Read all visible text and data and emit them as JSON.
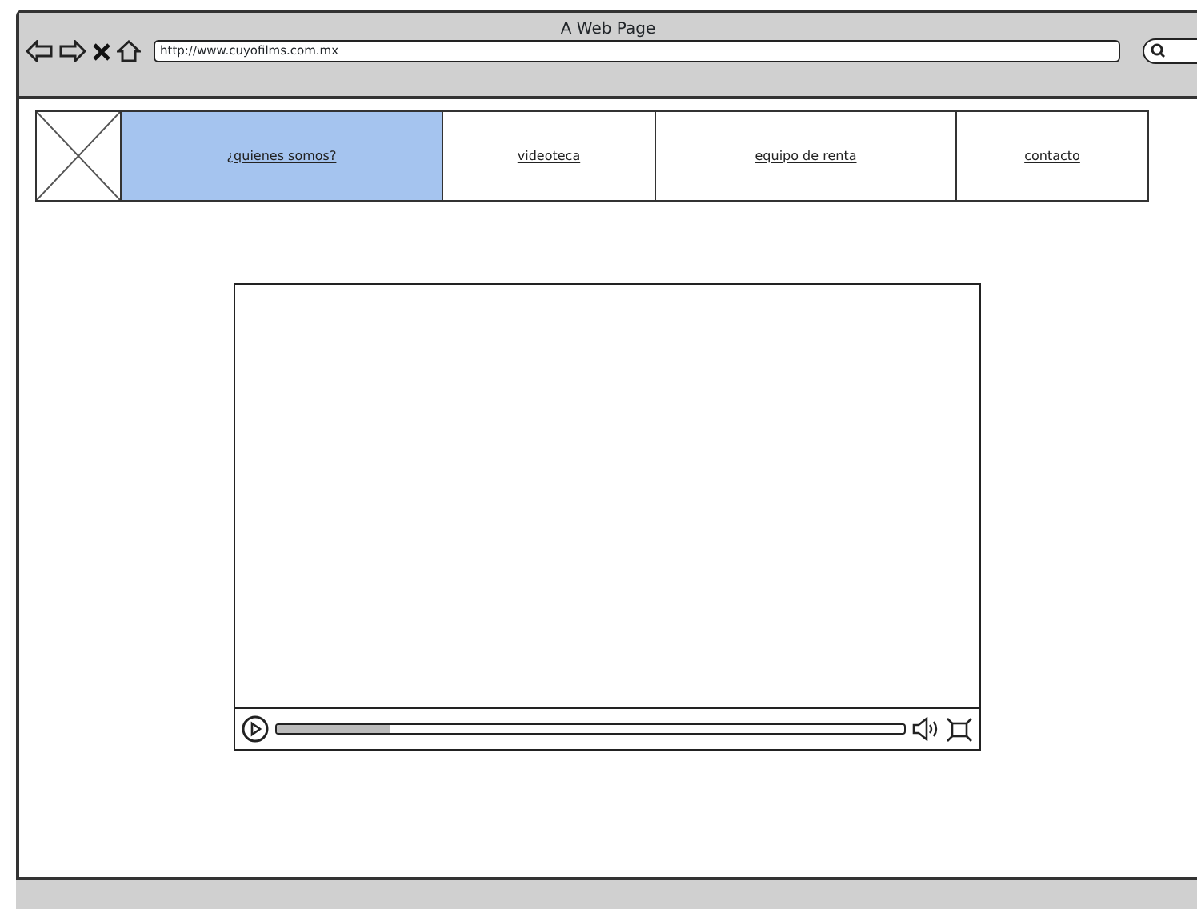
{
  "window": {
    "title": "A Web Page"
  },
  "address_bar": {
    "value": "http://www.cuyofilms.com.mx"
  },
  "nav": [
    {
      "label": "¿quienes somos?",
      "selected": true
    },
    {
      "label": "videoteca",
      "selected": false
    },
    {
      "label": "equipo de renta",
      "selected": false
    },
    {
      "label": "contacto",
      "selected": false
    }
  ],
  "video": {
    "level": 0.18
  }
}
